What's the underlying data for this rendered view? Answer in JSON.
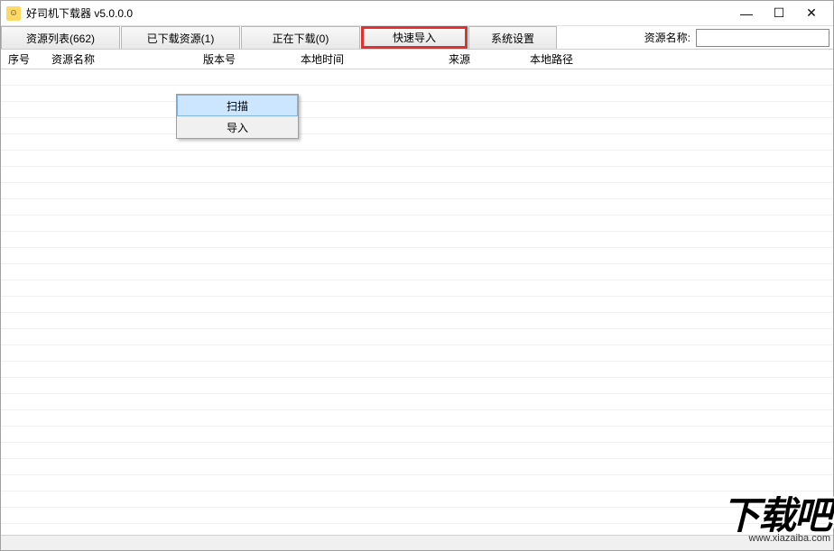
{
  "window": {
    "title": "好司机下载器 v5.0.0.0"
  },
  "tabs": {
    "resource_list": "资源列表(662)",
    "downloaded": "已下载资源(1)",
    "downloading": "正在下载(0)",
    "quick_import": "快速导入",
    "system_settings": "系统设置"
  },
  "search": {
    "label": "资源名称:",
    "value": ""
  },
  "columns": {
    "seq": "序号",
    "name": "资源名称",
    "version": "版本号",
    "local_time": "本地时间",
    "source": "来源",
    "local_path": "本地路径"
  },
  "context_menu": {
    "scan": "扫描",
    "import": "导入"
  },
  "watermark": {
    "main": "下载吧",
    "sub": "www.xiazaiba.com"
  }
}
